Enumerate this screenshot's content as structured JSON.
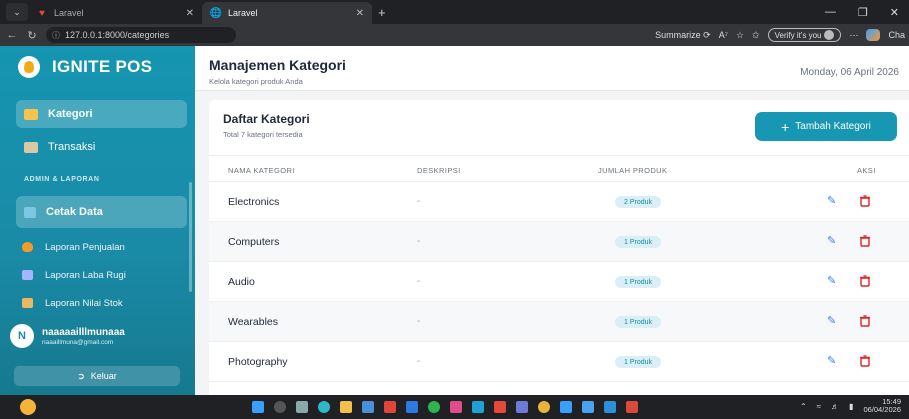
{
  "browser": {
    "tabs": [
      {
        "title": "Laravel",
        "active": false
      },
      {
        "title": "Laravel",
        "active": true
      }
    ],
    "url": "127.0.0.1:8000/categories",
    "summarize_label": "Summarize",
    "verify_label": "Verify it's you",
    "copilot_label": "Cha"
  },
  "sidebar": {
    "brand": "IGNITE POS",
    "items": [
      {
        "label": "Kategori",
        "active": true,
        "icon": "folder-icon",
        "color": "#f6c44c"
      },
      {
        "label": "Transaksi",
        "active": false,
        "icon": "receipt-icon",
        "color": "#d9c9a3"
      }
    ],
    "section_title": "ADMIN & LAPORAN",
    "print_item": {
      "label": "Cetak Data",
      "icon": "printer-icon"
    },
    "reports": [
      {
        "label": "Laporan Penjualan",
        "icon": "fire-icon",
        "color": "#f39a2b"
      },
      {
        "label": "Laporan Laba Rugi",
        "icon": "chart-icon",
        "color": "#a5b4fc"
      },
      {
        "label": "Laporan Nilai Stok",
        "icon": "box-icon",
        "color": "#e8b865"
      }
    ],
    "user": {
      "initial": "N",
      "name": "naaaaailllmunaaa",
      "email": "naaaillmuna@gmail.com"
    },
    "logout_label": "Keluar"
  },
  "header": {
    "title": "Manajemen Kategori",
    "subtitle": "Kelola kategori produk Anda",
    "date": "Monday, 06 April 2026"
  },
  "card": {
    "title": "Daftar Kategori",
    "subtitle": "Total 7 kategori tersedia",
    "add_label": "Tambah Kategori"
  },
  "table": {
    "columns": [
      "NAMA KATEGORI",
      "DESKRIPSI",
      "JUMLAH PRODUK",
      "AKSI"
    ],
    "rows": [
      {
        "name": "Electronics",
        "desc": "-",
        "count": "2 Produk"
      },
      {
        "name": "Computers",
        "desc": "-",
        "count": "1 Produk"
      },
      {
        "name": "Audio",
        "desc": "-",
        "count": "1 Produk"
      },
      {
        "name": "Wearables",
        "desc": "-",
        "count": "1 Produk"
      },
      {
        "name": "Photography",
        "desc": "-",
        "count": "1 Produk"
      }
    ]
  },
  "taskbar": {
    "time": "15:49",
    "date": "06/04/2026"
  },
  "colors": {
    "accent": "#1797b3",
    "sidebar": "#1a8aa6",
    "delete": "#dc2626",
    "edit": "#3b82f6"
  }
}
